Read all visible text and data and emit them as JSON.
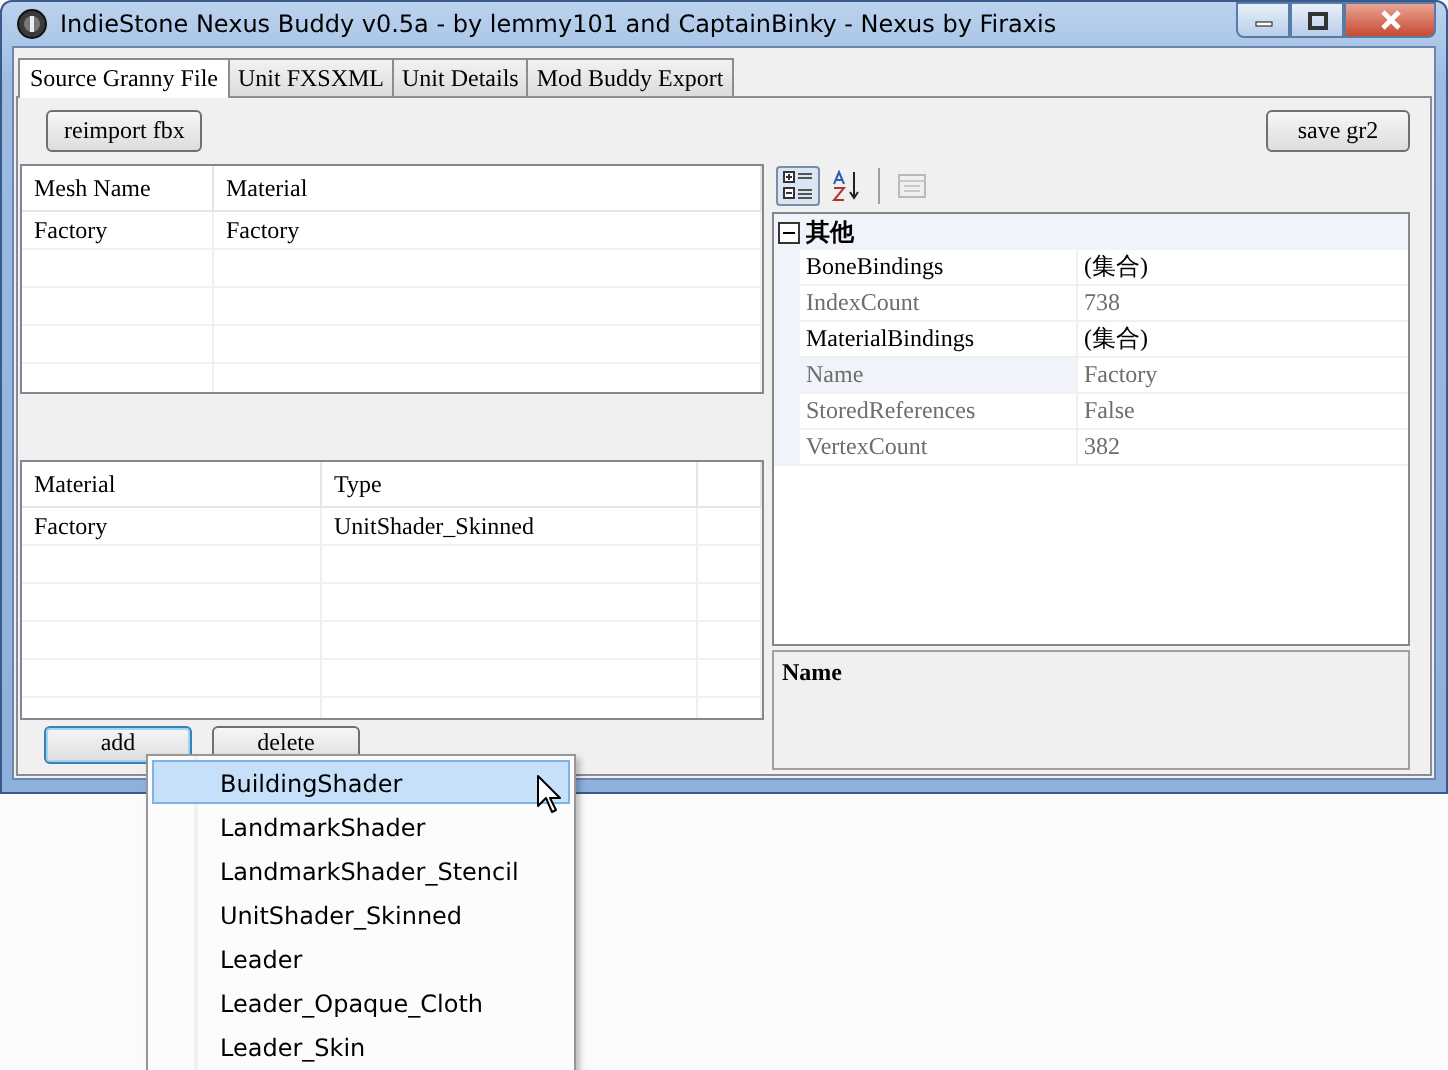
{
  "window": {
    "title": "IndieStone Nexus Buddy v0.5a - by lemmy101 and CaptainBinky - Nexus by Firaxis"
  },
  "tabs": [
    {
      "label": "Source Granny File",
      "selected": true
    },
    {
      "label": "Unit FXSXML",
      "selected": false
    },
    {
      "label": "Unit Details",
      "selected": false
    },
    {
      "label": "Mod Buddy Export",
      "selected": false
    }
  ],
  "top_buttons": {
    "left": "reimport fbx",
    "right": "save gr2"
  },
  "mesh_table": {
    "columns": [
      "Mesh Name",
      "Material"
    ],
    "rows": [
      [
        "Factory",
        "Factory"
      ]
    ]
  },
  "material_table": {
    "columns": [
      "Material",
      "Type"
    ],
    "rows": [
      [
        "Factory",
        "UnitShader_Skinned"
      ]
    ]
  },
  "table_buttons": [
    {
      "label": "add",
      "focused": true
    },
    {
      "label": "delete",
      "focused": false
    }
  ],
  "property_grid": {
    "toolbar": [
      {
        "kind": "categorized",
        "selected": true,
        "disabled": false
      },
      {
        "kind": "alphabetical",
        "selected": false,
        "disabled": false
      },
      {
        "kind": "pages",
        "selected": false,
        "disabled": true
      }
    ],
    "category": {
      "label": "其他",
      "expanded": true
    },
    "properties": [
      {
        "name": "BoneBindings",
        "value": "(集合)",
        "readonly": false,
        "selected": false
      },
      {
        "name": "IndexCount",
        "value": "738",
        "readonly": true,
        "selected": false
      },
      {
        "name": "MaterialBindings",
        "value": "(集合)",
        "readonly": false,
        "selected": false
      },
      {
        "name": "Name",
        "value": "Factory",
        "readonly": true,
        "selected": true
      },
      {
        "name": "StoredReferences",
        "value": "False",
        "readonly": true,
        "selected": false
      },
      {
        "name": "VertexCount",
        "value": "382",
        "readonly": true,
        "selected": false
      }
    ],
    "description": {
      "title": "Name"
    }
  },
  "dropdown_menu": [
    {
      "label": "BuildingShader",
      "selected": true
    },
    {
      "label": "LandmarkShader",
      "selected": false
    },
    {
      "label": "LandmarkShader_Stencil",
      "selected": false
    },
    {
      "label": "UnitShader_Skinned",
      "selected": false
    },
    {
      "label": "Leader",
      "selected": false
    },
    {
      "label": "Leader_Opaque_Cloth",
      "selected": false
    },
    {
      "label": "Leader_Skin",
      "selected": false
    }
  ]
}
